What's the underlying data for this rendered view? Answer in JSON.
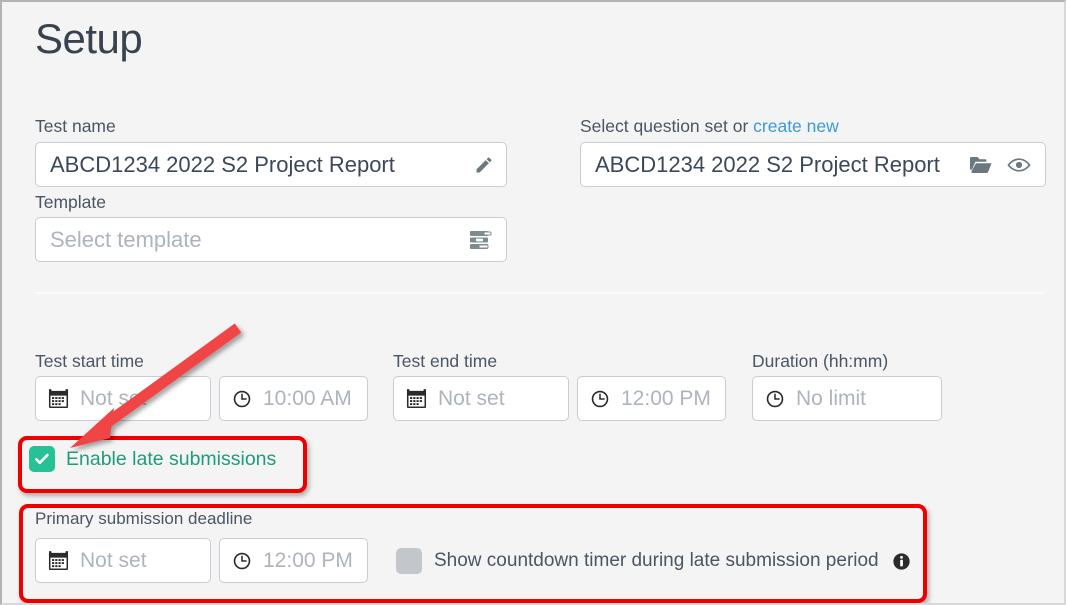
{
  "page": {
    "title": "Setup"
  },
  "test_name": {
    "label": "Test name",
    "value": "ABCD1234 2022 S2 Project Report",
    "edit_icon": "pencil-icon"
  },
  "template": {
    "label": "Template",
    "placeholder": "Select template",
    "value": "",
    "picker_icon": "list-icon"
  },
  "question_set": {
    "label_prefix": "Select question set or ",
    "link_label": "create new",
    "value": "ABCD1234 2022 S2 Project Report",
    "open_icon": "folder-open-icon",
    "preview_icon": "eye-icon"
  },
  "schedule": {
    "start": {
      "label": "Test start time",
      "date_value": "Not set",
      "time_value": "10:00 AM"
    },
    "end": {
      "label": "Test end time",
      "date_value": "Not set",
      "time_value": "12:00 PM"
    },
    "duration": {
      "label": "Duration (hh:mm)",
      "value": "No limit"
    }
  },
  "late_submissions": {
    "label": "Enable late submissions",
    "checked": true,
    "accent_color": "#27c198",
    "text_color": "#1f9c7c"
  },
  "primary_deadline": {
    "label": "Primary submission deadline",
    "date_value": "Not set",
    "time_value": "12:00 PM",
    "countdown_label": "Show countdown timer during late submission period",
    "countdown_checked": false,
    "info_icon": "info-icon"
  },
  "annotations": {
    "highlight_color": "#ef0000",
    "arrow_color": "#f14545",
    "boxes": [
      {
        "name": "enable-late-submissions-highlight"
      },
      {
        "name": "primary-submission-deadline-highlight"
      }
    ],
    "arrow": {
      "name": "pointer-arrow",
      "points_to": "enable-late-submissions-checkbox"
    }
  }
}
